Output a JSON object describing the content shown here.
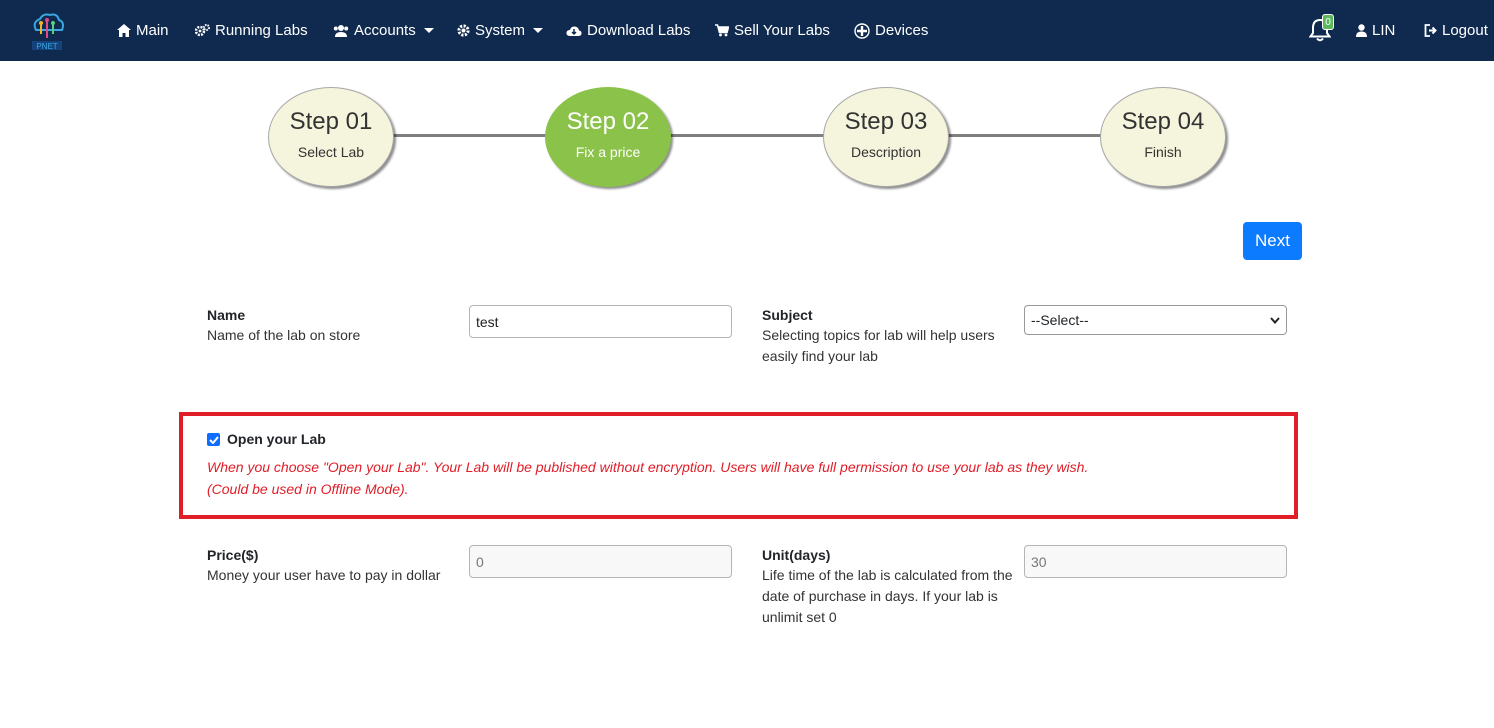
{
  "navbar": {
    "logo_text": "PNET",
    "items": [
      {
        "label": "Main",
        "icon": "home-icon"
      },
      {
        "label": "Running Labs",
        "icon": "cogs-icon"
      },
      {
        "label": "Accounts",
        "icon": "users-icon"
      },
      {
        "label": "System",
        "icon": "gear-icon"
      },
      {
        "label": "Download Labs",
        "icon": "cloud-download-icon"
      },
      {
        "label": "Sell Your Labs",
        "icon": "cart-icon"
      },
      {
        "label": "Devices",
        "icon": "plus-circle-icon"
      }
    ],
    "notification_count": "0",
    "user": "LIN",
    "logout": "Logout"
  },
  "steps": [
    {
      "title": "Step 01",
      "subtitle": "Select Lab"
    },
    {
      "title": "Step 02",
      "subtitle": "Fix a price",
      "active": true
    },
    {
      "title": "Step 03",
      "subtitle": "Description"
    },
    {
      "title": "Step 04",
      "subtitle": "Finish"
    }
  ],
  "next_label": "Next",
  "form": {
    "name": {
      "label": "Name",
      "description": "Name of the lab on store",
      "value": "test"
    },
    "subject": {
      "label": "Subject",
      "description_line1": "Selecting topics for lab will help users",
      "description_line2": "easily find your lab",
      "selected": "--Select--"
    },
    "open_lab": {
      "label": "Open your Lab",
      "checked": true,
      "warning_line1": "When you choose \"Open your Lab\". Your Lab will be published without encryption. Users will have full permission to use your lab as they wish.",
      "warning_line2": "(Could be used in Offline Mode)."
    },
    "price": {
      "label": "Price($)",
      "description": "Money your user have to pay in dollar",
      "value": "0"
    },
    "unit": {
      "label": "Unit(days)",
      "description_line1": "Life time of the lab is calculated from the",
      "description_line2": "date of purchase in days. If your lab is",
      "description_line3": "unlimit set 0",
      "value": "30"
    }
  },
  "colors": {
    "navbar": "#0f2a4e",
    "active_step": "#8bc34a",
    "step": "#f5f4dc",
    "primary": "#0d7bff",
    "warning": "#e01e28"
  }
}
